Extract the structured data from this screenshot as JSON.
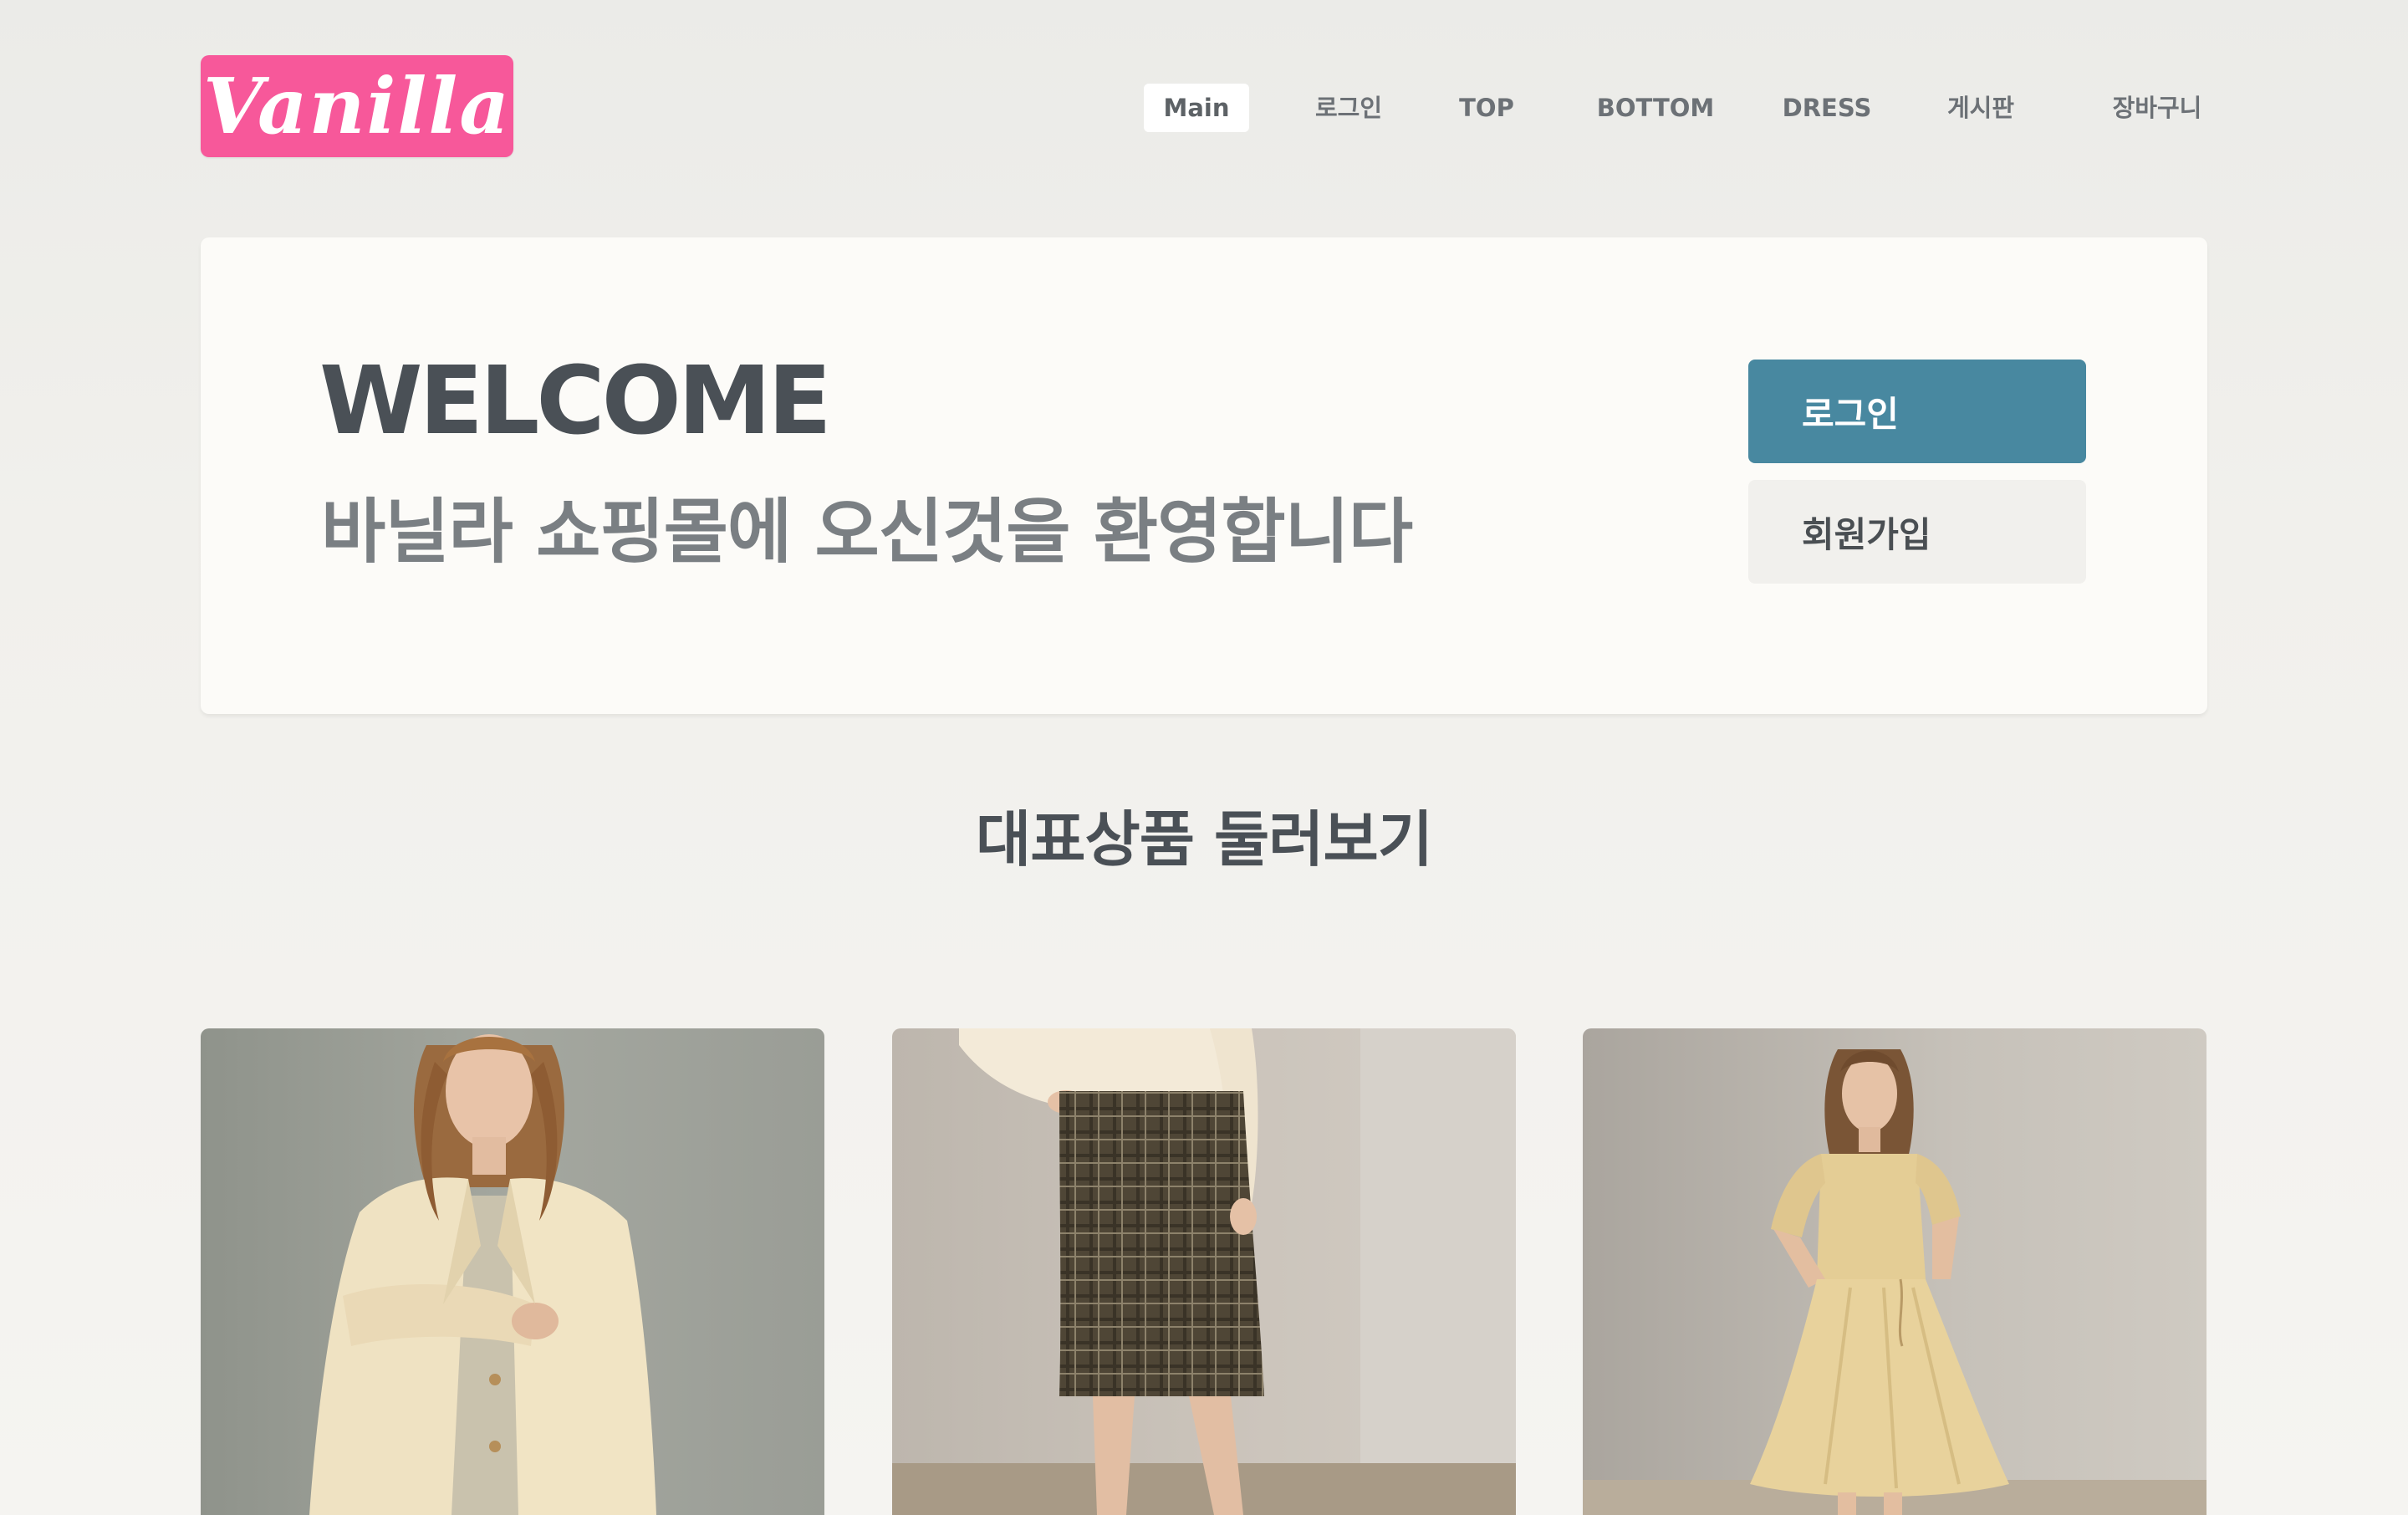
{
  "header": {
    "logo_text": "Vanilla",
    "brand_color": "#f7589a",
    "nav": [
      {
        "label": "Main",
        "active": true
      },
      {
        "label": "로그인",
        "active": false
      },
      {
        "label": "TOP",
        "active": false
      },
      {
        "label": "BOTTOM",
        "active": false
      },
      {
        "label": "DRESS",
        "active": false
      },
      {
        "label": "게시판",
        "active": false
      },
      {
        "label": "장바구니",
        "active": false
      }
    ]
  },
  "welcome": {
    "title": "WELCOME",
    "subtitle": "바닐라 쇼핑몰에 오신것을 환영합니다",
    "login_button": "로그인",
    "signup_button": "회원가입",
    "accent_color": "#4888a0"
  },
  "products": {
    "section_title": "대표상품 둘러보기",
    "items": [
      {
        "image_icon": "blazer-model-photo"
      },
      {
        "image_icon": "plaid-skirt-model-photo"
      },
      {
        "image_icon": "beige-dress-model-photo"
      }
    ]
  }
}
